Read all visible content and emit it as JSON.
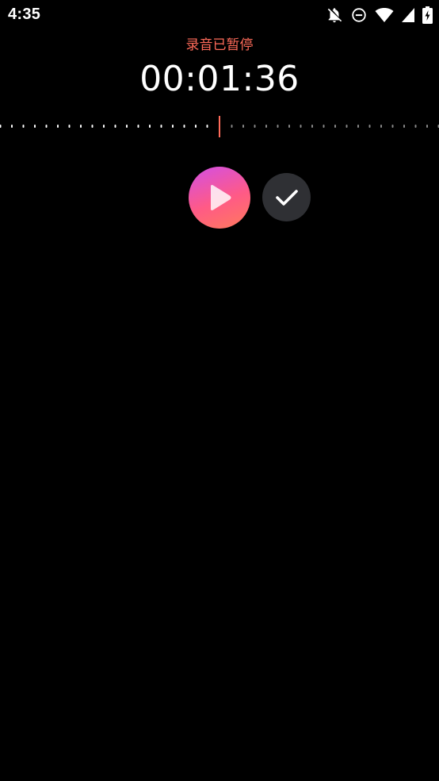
{
  "status_bar": {
    "time": "4:35",
    "icons": [
      "notifications-off-icon",
      "do-not-disturb-icon",
      "wifi-icon",
      "cellular-signal-icon",
      "battery-charging-icon"
    ]
  },
  "recorder": {
    "status_text": "录音已暂停",
    "elapsed_time": "00:01:36",
    "accent_color": "#ff6b5a",
    "play_button_icon": "play-icon",
    "done_button_icon": "check-icon"
  }
}
